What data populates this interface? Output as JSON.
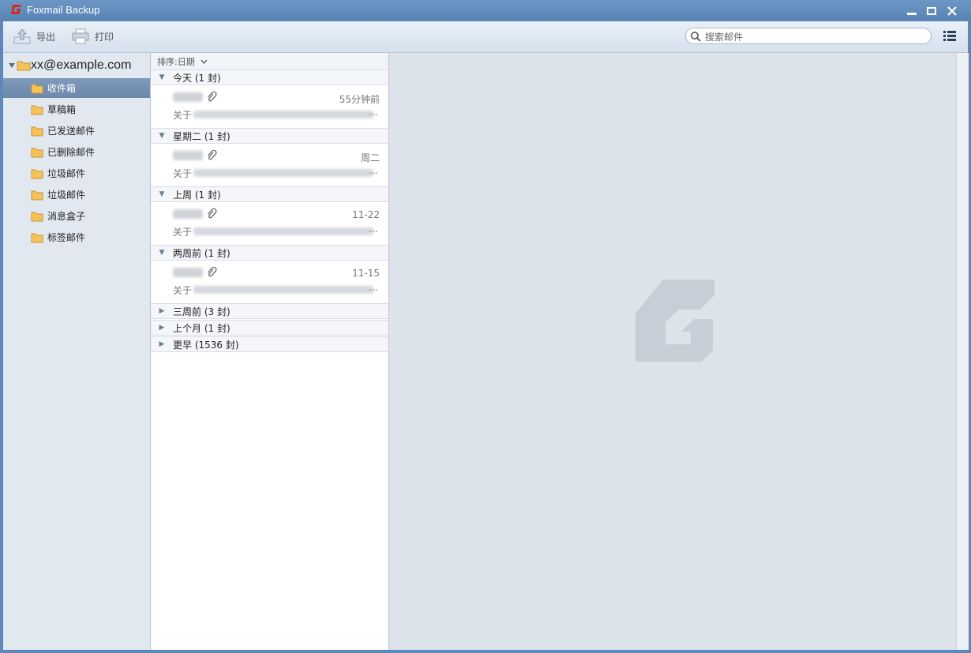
{
  "window": {
    "title": "Foxmail Backup"
  },
  "toolbar": {
    "export_label": "导出",
    "print_label": "打印",
    "search_placeholder": "搜索邮件"
  },
  "sidebar": {
    "account": "xx@example.com",
    "folders": [
      {
        "label": "收件箱",
        "selected": true
      },
      {
        "label": "草稿箱"
      },
      {
        "label": "已发送邮件"
      },
      {
        "label": "已删除邮件"
      },
      {
        "label": "垃圾邮件"
      },
      {
        "label": "垃圾邮件"
      },
      {
        "label": "消息盒子"
      },
      {
        "label": "标签邮件"
      }
    ]
  },
  "list": {
    "sort_label": "排序:日期",
    "groups": [
      {
        "label": "今天 (1 封)",
        "expanded": true,
        "date": "55分钟前",
        "subject_prefix": "关于"
      },
      {
        "label": "星期二 (1 封)",
        "expanded": true,
        "date": "周二",
        "subject_prefix": "关于"
      },
      {
        "label": "上周 (1 封)",
        "expanded": true,
        "date": "11-22",
        "subject_prefix": "关于"
      },
      {
        "label": "两周前 (1 封)",
        "expanded": true,
        "date": "11-15",
        "subject_prefix": "关于"
      },
      {
        "label": "三周前 (3 封)",
        "expanded": false
      },
      {
        "label": "上个月 (1 封)",
        "expanded": false
      },
      {
        "label": "更早 (1536 封)",
        "expanded": false
      }
    ]
  },
  "colors": {
    "titlebar": "#5d88b8",
    "selection": "#7390b3",
    "brand_red": "#d9261c"
  },
  "icons": [
    "foxmail-logo-icon",
    "export-icon",
    "print-icon",
    "search-icon",
    "menu-icon",
    "folder-icon",
    "attachment-icon",
    "triangle-icon"
  ]
}
